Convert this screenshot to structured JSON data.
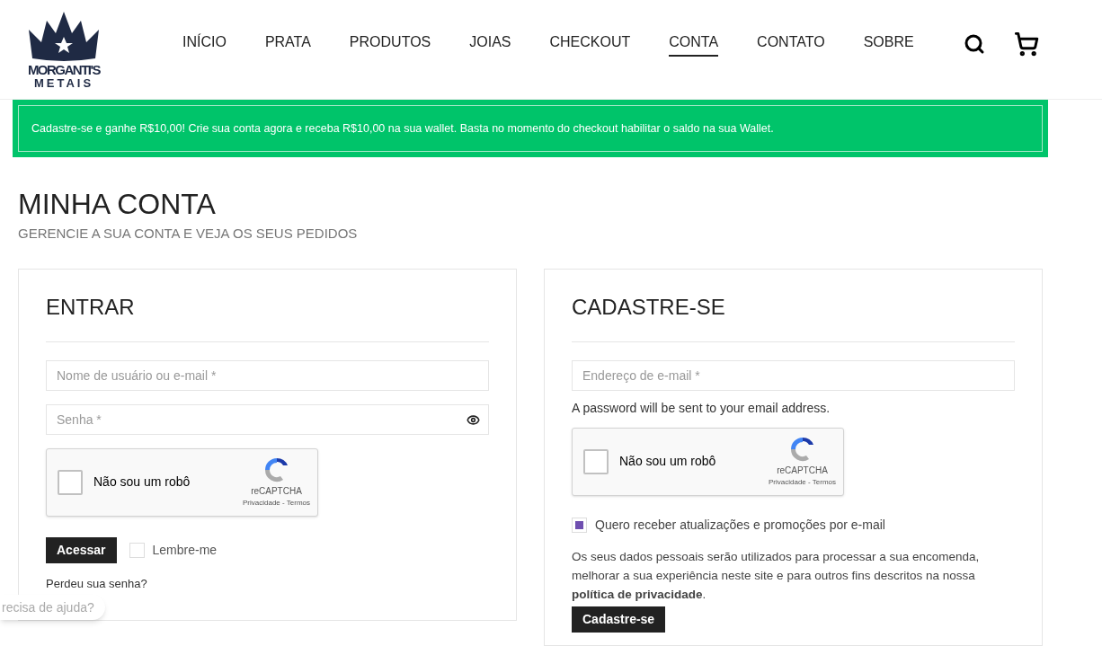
{
  "logo": {
    "line_1": "MORGANTI'S",
    "line_2": "METAIS"
  },
  "nav": [
    {
      "label": "INÍCIO",
      "selected": false
    },
    {
      "label": "PRATA",
      "selected": false
    },
    {
      "label": "PRODUTOS",
      "selected": false
    },
    {
      "label": "JOIAS",
      "selected": false
    },
    {
      "label": "CHECKOUT",
      "selected": false
    },
    {
      "label": "CONTA",
      "selected": true
    },
    {
      "label": "CONTATO",
      "selected": false
    },
    {
      "label": "SOBRE",
      "selected": false
    }
  ],
  "banner": "Cadastre-se e ganhe R$10,00! Crie sua conta agora e receba R$10,00 na sua wallet. Basta no momento do checkout habilitar o saldo na sua Wallet.",
  "page": {
    "title": "MINHA CONTA",
    "subtitle": "GERENCIE A SUA CONTA E VEJA OS SEUS PEDIDOS"
  },
  "login": {
    "title": "ENTRAR",
    "username": {
      "placeholder": "Nome de usuário ou e-mail *"
    },
    "password": {
      "placeholder": "Senha *"
    },
    "captcha": {
      "label": "Não sou um robô",
      "checked": false,
      "brand": "reCAPTCHA",
      "links": "Privacidade - Termos"
    },
    "button": "Acessar",
    "remember": {
      "label": "Lembre-me",
      "checked": false
    },
    "lost_password": "Perdeu sua senha?"
  },
  "register": {
    "title": "CADASTRE-SE",
    "email": {
      "placeholder": "Endereço de e-mail *"
    },
    "note": "A password will be sent to your email address.",
    "captcha": {
      "label": "Não sou um robô",
      "checked": false,
      "brand": "reCAPTCHA",
      "links": "Privacidade - Termos"
    },
    "newsletter": {
      "label": "Quero receber atualizações e promoções por e-mail",
      "checked": true
    },
    "privacy": "Os seus dados pessoais serão utilizados para processar a sua encomenda, melhorar a sua experiência neste site e para outros fins descritos na nossa **política de privacidade**.",
    "button": "Cadastre-se"
  },
  "help_bubble": "recisa de ajuda?"
}
